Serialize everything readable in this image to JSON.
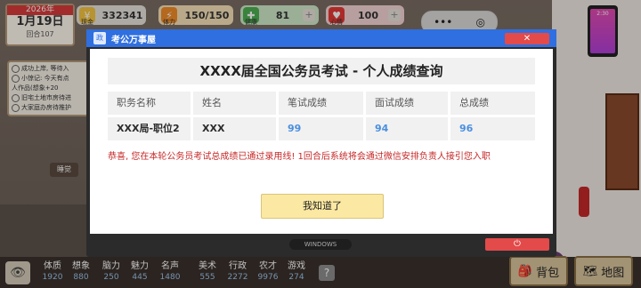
{
  "date": {
    "year": "2026年",
    "day": "1月19日",
    "turn": "回合107"
  },
  "stats": [
    {
      "label": "现金",
      "value": "332341",
      "icon": "coin-icon",
      "color": "#f5c542"
    },
    {
      "label": "体力",
      "value": "150/150",
      "icon": "lightning-icon",
      "color": "#f28c28"
    },
    {
      "label": "健康",
      "value": "81",
      "icon": "health-cross-icon",
      "color": "#4caf50"
    },
    {
      "label": "心情",
      "value": "100",
      "icon": "heart-icon",
      "color": "#e53935"
    }
  ],
  "capsule": {
    "more": "•••",
    "target": "◎"
  },
  "phone": {
    "time": "2:30"
  },
  "events": [
    "成功上岸, 等待入",
    "小惊记: 今天有点",
    "人作品(想象+20",
    "旧宅土地市房待进",
    "大家庭办房待推护"
  ],
  "sidebar_tab": "睡觉",
  "dialog": {
    "title": "考公万事屋",
    "close": "✕",
    "result_title": "XXXX届全国公务员考试 - 个人成绩查询",
    "headers": [
      "职务名称",
      "姓名",
      "笔试成绩",
      "面试成绩",
      "总成绩"
    ],
    "row": [
      "XXX局-职位2",
      "XXX",
      "99",
      "94",
      "96"
    ],
    "congrats": "恭喜, 您在本轮公务员考试总成绩已通过录用线! 1回合后系统将会通过微信安排负责人接引您入职",
    "ok": "我知道了",
    "taskbar": "WINDOWS",
    "power": "⏻"
  },
  "attributes": [
    {
      "label": "体质",
      "value": "1920"
    },
    {
      "label": "想象",
      "value": "880"
    },
    {
      "label": "脑力",
      "value": "250"
    },
    {
      "label": "魅力",
      "value": "445"
    },
    {
      "label": "名声",
      "value": "1480"
    },
    {
      "label": "美术",
      "value": "555"
    },
    {
      "label": "行政",
      "value": "2272"
    },
    {
      "label": "农才",
      "value": "9976"
    },
    {
      "label": "游戏",
      "value": "274"
    }
  ],
  "help": "?",
  "bag": "背包",
  "map": "地图"
}
